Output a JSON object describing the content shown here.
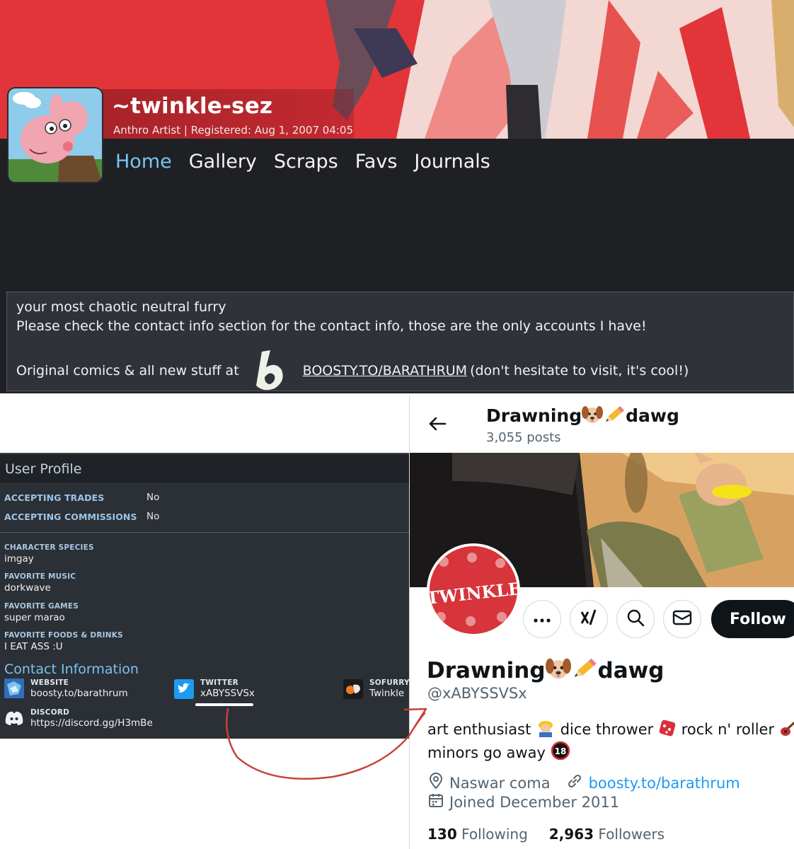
{
  "fa": {
    "username": "~twinkle-sez",
    "subtitle": "Anthro Artist | Registered: Aug 1, 2007 04:05",
    "nav": [
      "Home",
      "Gallery",
      "Scraps",
      "Favs",
      "Journals"
    ],
    "description": {
      "line1": "your most chaotic neutral furry",
      "line2": "Please check the contact info section for the contact info, those are the only accounts I have!",
      "line3_prefix": "Original comics & all new stuff at",
      "line3_link": "BOOSTY.TO/BARATHRUM",
      "line3_suffix": "(don't hesitate to visit, it's cool!)"
    }
  },
  "user_profile": {
    "title": "User Profile",
    "trades_label": "ACCEPTING TRADES",
    "trades_value": "No",
    "commissions_label": "ACCEPTING COMMISSIONS",
    "commissions_value": "No",
    "fields": [
      {
        "label": "CHARACTER SPECIES",
        "value": "imgay"
      },
      {
        "label": "FAVORITE MUSIC",
        "value": "dorkwave"
      },
      {
        "label": "FAVORITE GAMES",
        "value": "super marao"
      },
      {
        "label": "FAVORITE FOODS & DRINKS",
        "value": "I EAT ASS :U"
      }
    ],
    "contact_title": "Contact Information",
    "contacts": {
      "website_label": "WEBSITE",
      "website_value": "boosty.to/barathrum",
      "twitter_label": "TWITTER",
      "twitter_value": "xABYSSVSx",
      "sofurry_label": "SOFURRY",
      "sofurry_value": "Twinkle",
      "discord_label": "DISCORD",
      "discord_value": "https://discord.gg/H3mBe"
    }
  },
  "twitter": {
    "header_name": "Drawning🐶✏️dawg",
    "header_name_parts": {
      "a": "Drawning",
      "b": "dawg"
    },
    "posts": "3,055 posts",
    "follow_label": "Follow",
    "name_parts": {
      "a": "Drawning",
      "b": "dawg"
    },
    "handle": "@xABYSSVSx",
    "bio_line1": {
      "a": "art enthusiast",
      "b": "dice thrower",
      "c": "rock n' roller"
    },
    "bio_line2": "minors go away",
    "location": "Naswar coma",
    "link": "boosty.to/barathrum",
    "joined": "Joined December 2011",
    "following_count": "130",
    "following_label": "Following",
    "followers_count": "2,963",
    "followers_label": "Followers",
    "avatar_text": "TWINKLE",
    "age_badge": "18"
  },
  "colors": {
    "fa_accent": "#79c4f2",
    "fa_banner_red": "#e2353a",
    "twitter_link": "#1d9bf0",
    "arrow_red": "#c9403a"
  },
  "icons": [
    "back-arrow-icon",
    "more-icon",
    "grok-icon",
    "search-icon",
    "mail-icon",
    "location-icon",
    "link-icon",
    "calendar-icon",
    "twitter-icon",
    "discord-icon",
    "website-icon",
    "sofurry-icon",
    "boosty-icon"
  ]
}
